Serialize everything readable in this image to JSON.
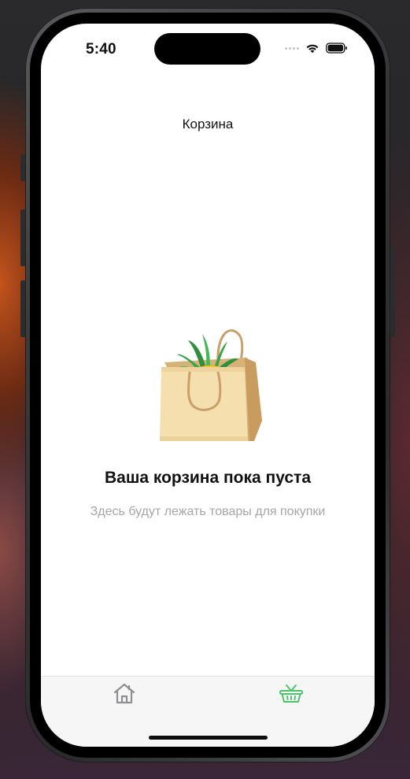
{
  "status_bar": {
    "time": "5:40",
    "icons": [
      "signal-dots-icon",
      "wifi-icon",
      "battery-icon"
    ]
  },
  "nav": {
    "title": "Корзина"
  },
  "empty_state": {
    "illustration": "grocery-bag-with-pineapple-icon",
    "title": "Ваша корзина пока пуста",
    "subtitle": "Здесь будут лежать товары для покупки"
  },
  "tab_bar": {
    "tabs": [
      {
        "icon": "home-icon",
        "active": false
      },
      {
        "icon": "basket-icon",
        "active": true
      }
    ],
    "active_color": "#4cc46a",
    "inactive_color": "#8e8e93"
  }
}
